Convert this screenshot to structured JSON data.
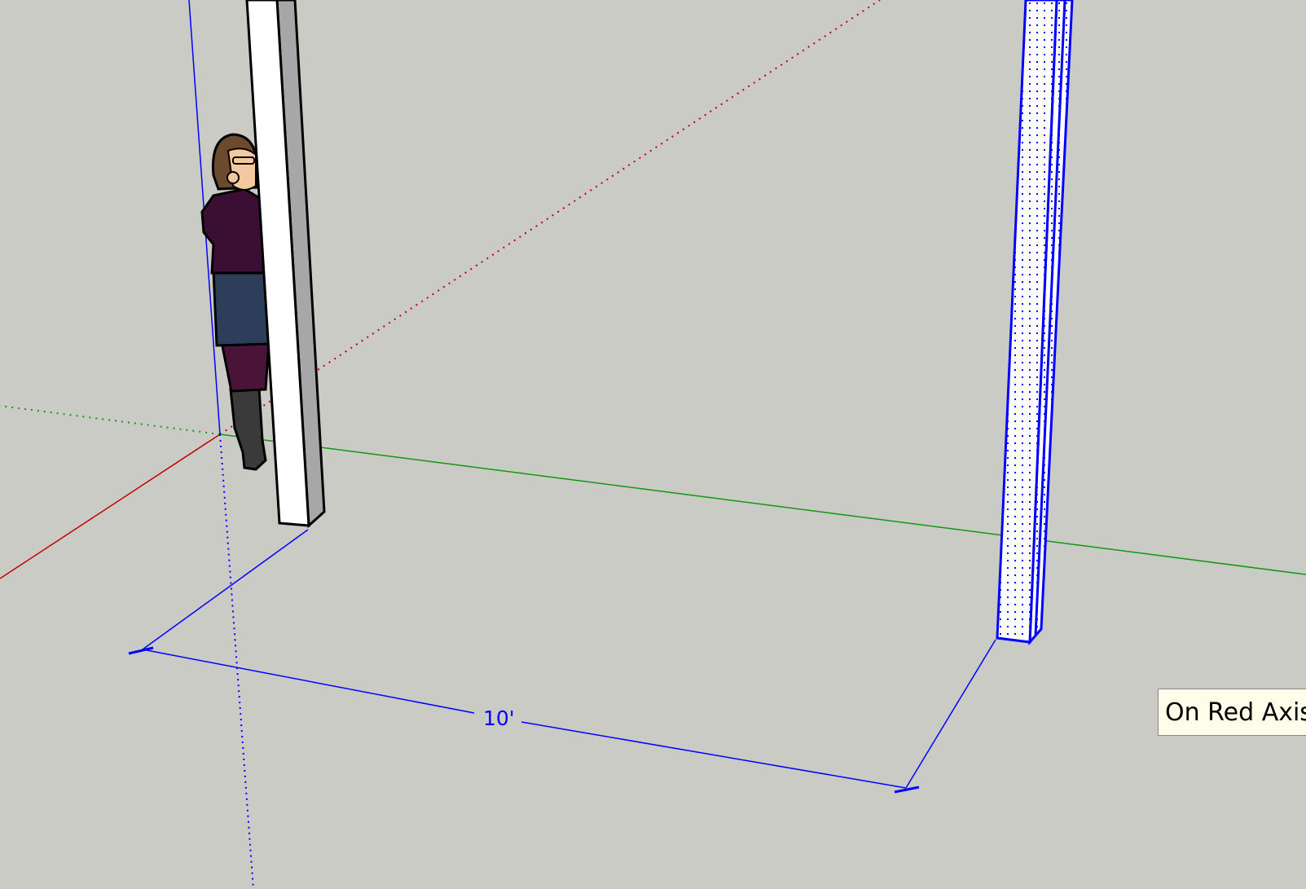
{
  "viewport": {
    "background": "#cbcbc6"
  },
  "axes": {
    "red_color": "#c00000",
    "green_color": "#109910",
    "blue_color": "#0000ff"
  },
  "dimension": {
    "label": "10'",
    "color": "#0000ff"
  },
  "tooltip": {
    "text": "On Red Axis"
  },
  "selection": {
    "color": "#0000ff"
  },
  "figure": {
    "hair": "#6b4a2e",
    "skin": "#f4c9a0",
    "top": "#3a0f33",
    "skirt": "#2c3e5a",
    "legs": "#4a1438",
    "boots": "#3a3a3a"
  }
}
